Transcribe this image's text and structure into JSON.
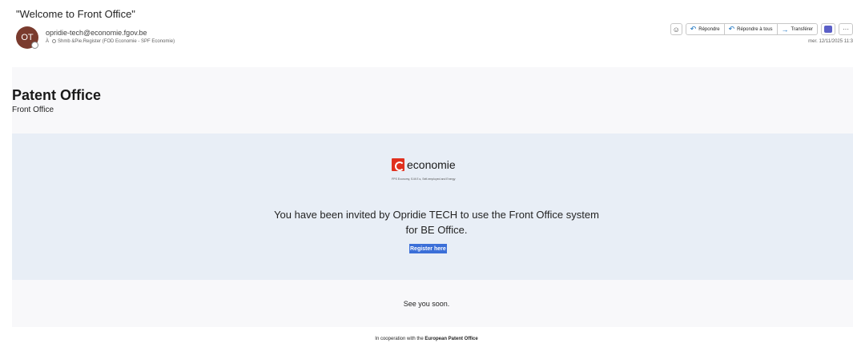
{
  "email": {
    "subject": "\"Welcome to Front Office\"",
    "avatar_initials": "OT",
    "sender_email": "opridie-tech@economie.fgov.be",
    "to_prefix": "À",
    "recipients": "Shmb &Pie.Register (FOD Economie - SPF Economie)",
    "date": "mer. 12/11/2025 11:3"
  },
  "toolbar": {
    "emoji_icon": "smiley-icon",
    "reply_label": "Répondre",
    "reply_all_label": "Répondre à tous",
    "forward_label": "Transférer",
    "teams_icon": "teams-icon",
    "more_label": "···"
  },
  "body": {
    "title": "Patent Office",
    "subtitle": "Front Office",
    "logo_text": "economie",
    "logo_sub": "FPS Economy, S.M.E.s, Self-employed and Energy",
    "invite_text": "You have been invited by Opridie TECH to use the Front Office system for BE Office.",
    "register_label": "Register here",
    "closing": "See you soon.",
    "coop_prefix": "In cooperation with the",
    "coop_org": "European Patent Office"
  },
  "colors": {
    "avatar": "#7a3b2e",
    "hero_bg": "#e8eef6",
    "register_bg": "#3b6fd8",
    "logo_red": "#e0301e"
  }
}
